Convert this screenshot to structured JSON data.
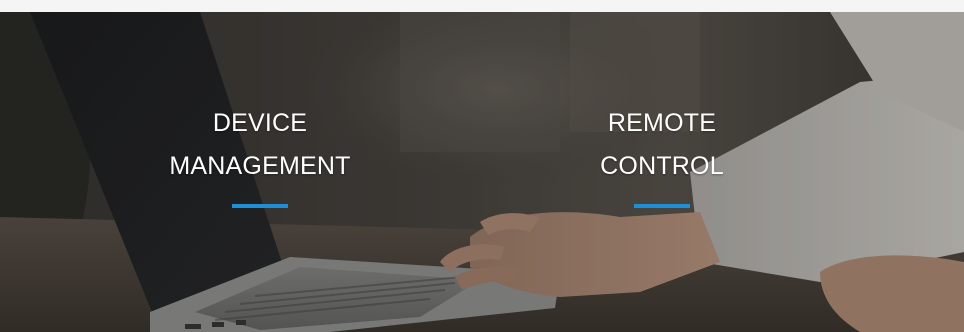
{
  "hero": {
    "features": [
      {
        "title": "DEVICE\nMANAGEMENT"
      },
      {
        "title": "REMOTE\nCONTROL"
      }
    ]
  },
  "colors": {
    "accent": "#1e8fd6",
    "text": "#ffffff",
    "overlay": "#000000"
  },
  "icons": {
    "background": "laptop-typing-photo"
  }
}
